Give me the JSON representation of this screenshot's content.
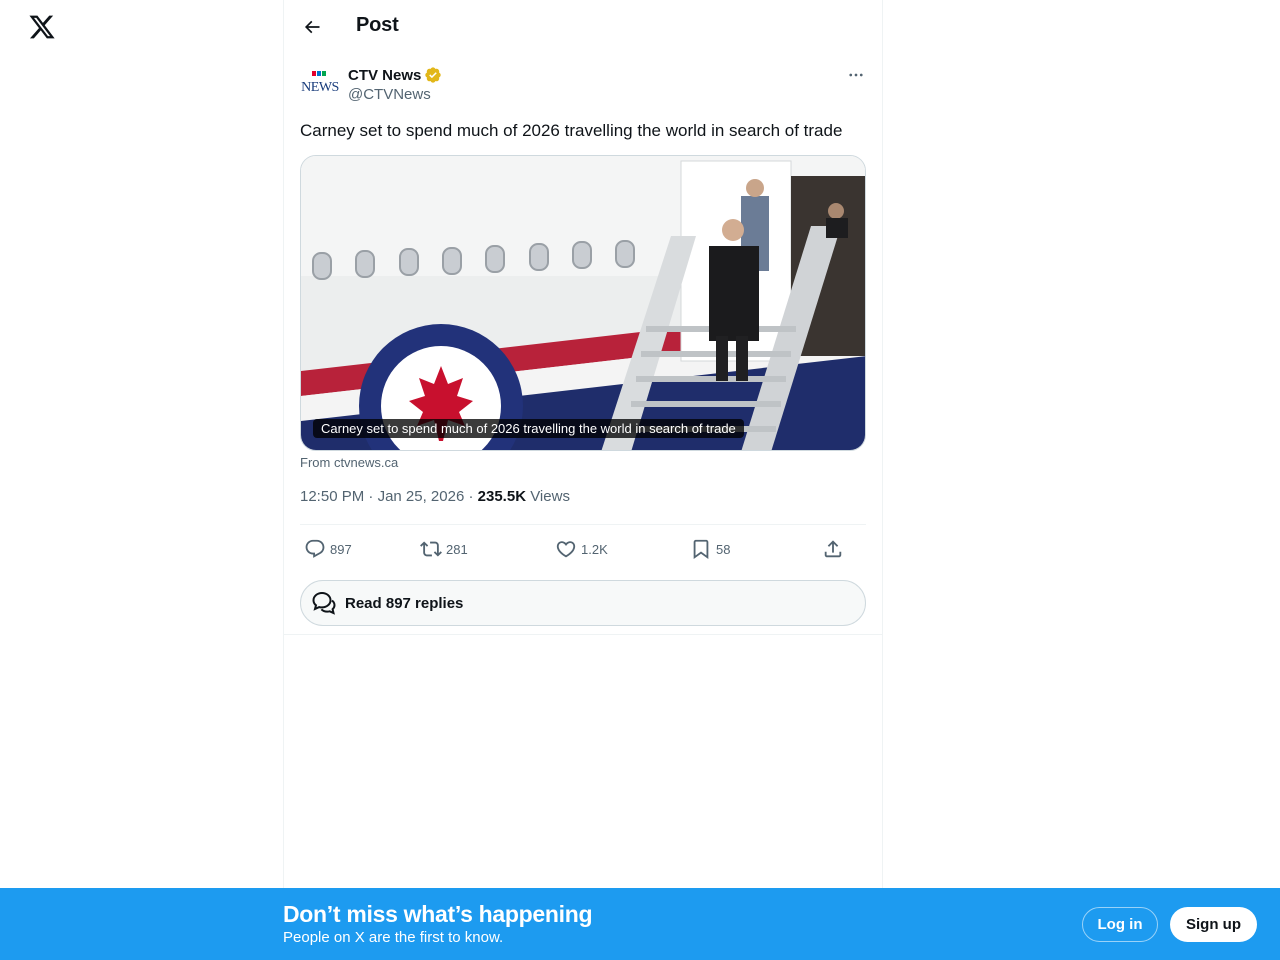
{
  "icons": {
    "logo": "x-logo-icon",
    "back": "arrow-left-icon",
    "verified": "verified-badge-icon",
    "more": "more-horizontal-icon",
    "reply": "reply-icon",
    "repost": "repost-icon",
    "like": "heart-icon",
    "bookmark": "bookmark-icon",
    "share": "share-icon",
    "replies": "chat-bubbles-icon"
  },
  "colors": {
    "accent": "#1d9bf0",
    "verified": "#e2b719",
    "text_primary": "#0f1419",
    "text_secondary": "#536471"
  },
  "header": {
    "title": "Post"
  },
  "post": {
    "author": {
      "display_name": "CTV News",
      "handle": "@CTVNews"
    },
    "text": "Carney set to spend much of 2026 travelling the world in search of trade",
    "card": {
      "caption": "Carney set to spend much of 2026 travelling the world in search of trade",
      "source": "From ctvnews.ca"
    },
    "time": "12:50 PM",
    "separator": " · ",
    "date": "Jan 25, 2026",
    "views_count": "235.5K",
    "views_label": "Views",
    "stats": {
      "replies": "897",
      "reposts": "281",
      "likes": "1.2K",
      "bookmarks": "58"
    },
    "read_replies_label": "Read 897 replies"
  },
  "banner": {
    "title": "Don’t miss what’s happening",
    "subtitle": "People on X are the first to know.",
    "login_label": "Log in",
    "signup_label": "Sign up"
  }
}
